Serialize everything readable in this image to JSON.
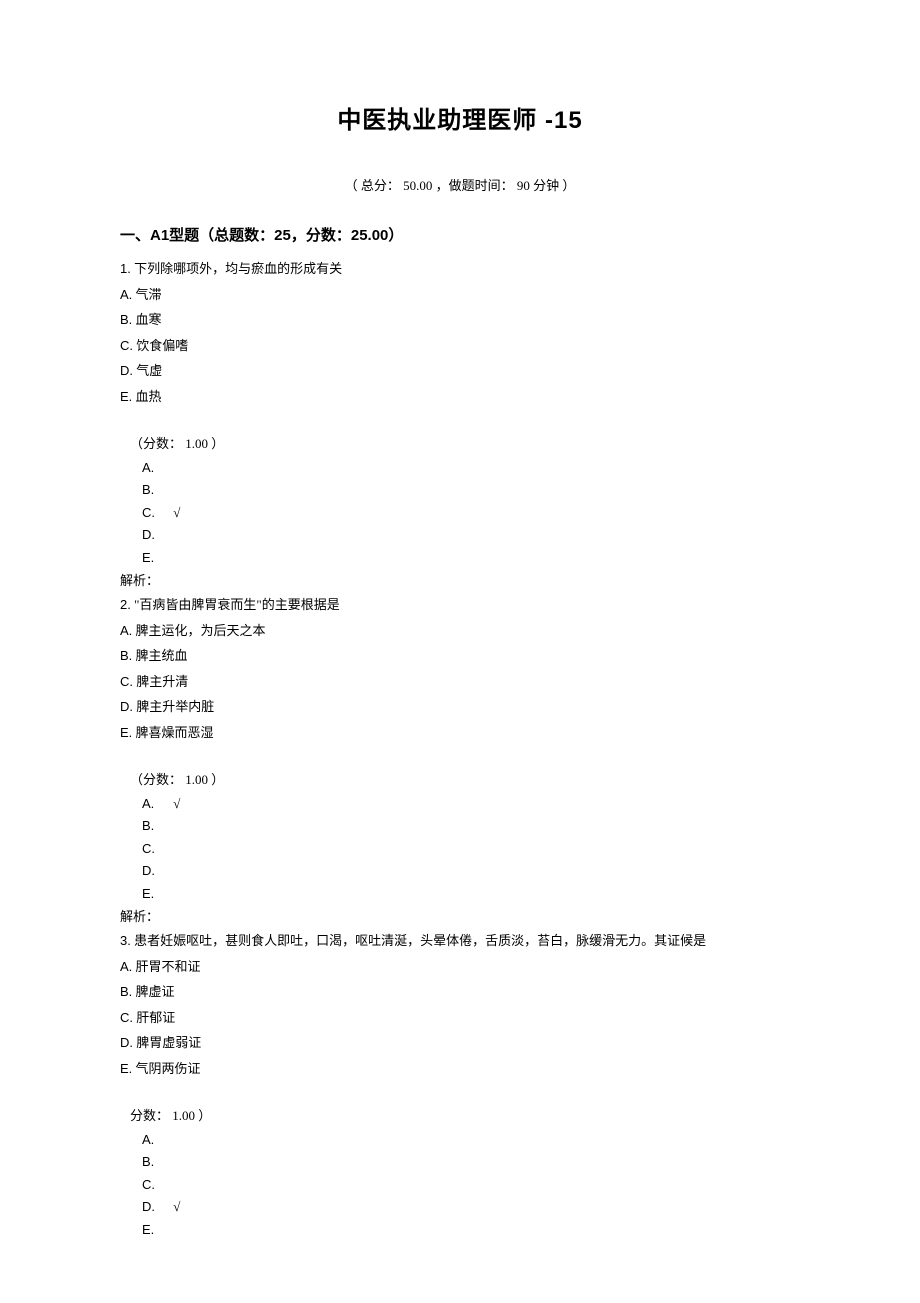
{
  "title": "中医执业助理医师  -15",
  "meta": "（ 总分：  50.00 ，做题时间：  90 分钟  ）",
  "section_header": "一、A1型题（总题数：25，分数：25.00）",
  "questions": [
    {
      "num": "1.",
      "stem": "  下列除哪项外，均与瘀血的形成有关",
      "opts": [
        {
          "letter": "A.",
          "text": "  气滞"
        },
        {
          "letter": "B.",
          "text": "  血寒"
        },
        {
          "letter": "C.",
          "text": "  饮食偏嗜"
        },
        {
          "letter": "D.",
          "text": "  气虚"
        },
        {
          "letter": "E.",
          "text": "  血热"
        }
      ],
      "score": "（分数：  1.00 ）",
      "answers": [
        {
          "label": "A.",
          "mark": ""
        },
        {
          "label": "B.",
          "mark": ""
        },
        {
          "label": "C.",
          "mark": " √"
        },
        {
          "label": "D.",
          "mark": ""
        },
        {
          "label": "E.",
          "mark": ""
        }
      ],
      "explain": "解析："
    },
    {
      "num": "2.",
      "stem": "  \"百病皆由脾胃衰而生\"的主要根据是",
      "opts": [
        {
          "letter": "A.",
          "text": " 脾主运化，为后天之本"
        },
        {
          "letter": "B.",
          "text": "  脾主统血"
        },
        {
          "letter": "C.",
          "text": "  脾主升清"
        },
        {
          "letter": "D.",
          "text": " 脾主升举内脏"
        },
        {
          "letter": "E.",
          "text": "  脾喜燥而恶湿"
        }
      ],
      "score": "（分数：  1.00 ）",
      "answers": [
        {
          "label": "A.",
          "mark": " √"
        },
        {
          "label": "B.",
          "mark": ""
        },
        {
          "label": "C.",
          "mark": ""
        },
        {
          "label": "D.",
          "mark": ""
        },
        {
          "label": "E.",
          "mark": ""
        }
      ],
      "explain": "解析："
    },
    {
      "num": "3.",
      "stem": "  患者妊娠呕吐，甚则食人即吐，口渴，呕吐清涎，头晕体倦，舌质淡，苔白，脉缓滑无力。其证候是",
      "opts": [
        {
          "letter": "A.",
          "text": "  肝胃不和证"
        },
        {
          "letter": "B.",
          "text": "  脾虚证"
        },
        {
          "letter": "C.",
          "text": "  肝郁证"
        },
        {
          "letter": "D.",
          "text": "  脾胃虚弱证"
        },
        {
          "letter": "E.",
          "text": "  气阴两伤证"
        }
      ],
      "score": "  分数：  1.00 ）",
      "answers": [
        {
          "label": "A.",
          "mark": ""
        },
        {
          "label": "B.",
          "mark": ""
        },
        {
          "label": "C.",
          "mark": ""
        },
        {
          "label": "D.",
          "mark": " √"
        },
        {
          "label": "E.",
          "mark": ""
        }
      ],
      "explain": ""
    }
  ]
}
